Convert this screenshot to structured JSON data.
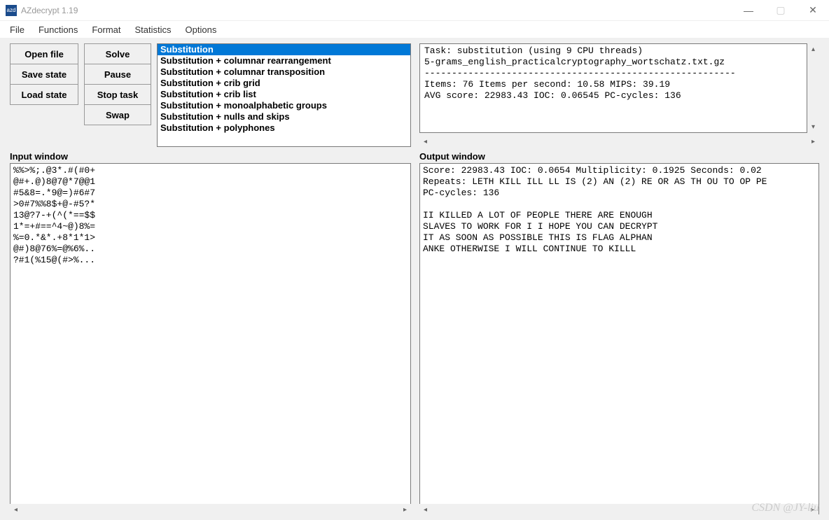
{
  "title": "AZdecrypt 1.19",
  "menu": {
    "file": "File",
    "functions": "Functions",
    "format": "Format",
    "statistics": "Statistics",
    "options": "Options"
  },
  "buttons": {
    "open_file": "Open file",
    "save_state": "Save state",
    "load_state": "Load state",
    "solve": "Solve",
    "pause": "Pause",
    "stop_task": "Stop task",
    "swap": "Swap"
  },
  "solver_list": [
    "Substitution",
    "Substitution + columnar rearrangement",
    "Substitution + columnar transposition",
    "Substitution + crib grid",
    "Substitution + crib list",
    "Substitution + monoalphabetic groups",
    "Substitution + nulls and skips",
    "Substitution + polyphones"
  ],
  "solver_selected_index": 0,
  "labels": {
    "input": "Input window",
    "output": "Output window"
  },
  "log_text": "Task: substitution (using 9 CPU threads)\n5-grams_english_practicalcryptography_wortschatz.txt.gz\n---------------------------------------------------------\nItems: 76 Items per second: 10.58 MIPS: 39.19\nAVG score: 22983.43 IOC: 0.06545 PC-cycles: 136",
  "input_text": "%%>%;.@3*.#(#0+\n@#+.@)8@7@*7@@1\n#5&8=.*9@=)#6#7\n>0#7%%8$+@-#5?*\n13@?7-+(^(*==$$\n1*=+#==^4~@)8%=\n%=0.*&*.+8*1*1>\n@#)8@76%=@%6%..\n?#1(%15@(#>%...",
  "output_text": "Score: 22983.43 IOC: 0.0654 Multiplicity: 0.1925 Seconds: 0.02\nRepeats: LETH KILL ILL LL IS (2) AN (2) RE OR AS TH OU TO OP PE\nPC-cycles: 136\n\nII KILLED A LOT OF PEOPLE THERE ARE ENOUGH\nSLAVES TO WORK FOR I I HOPE YOU CAN DECRYPT\nIT AS SOON AS POSSIBLE THIS IS FLAG ALPHAN\nANKE OTHERWISE I WILL CONTINUE TO KILLL",
  "watermark": "CSDN @JY-liu"
}
